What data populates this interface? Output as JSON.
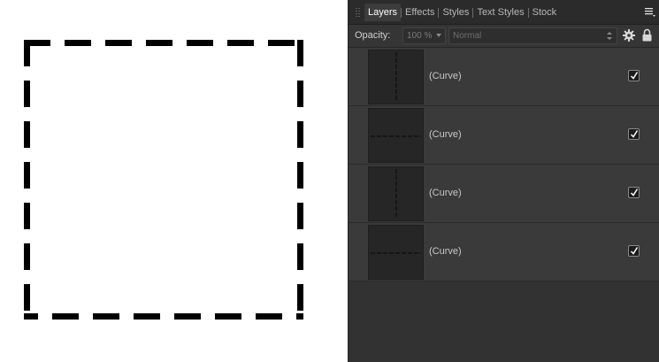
{
  "panel": {
    "tabs": [
      {
        "label": "Layers",
        "active": true
      },
      {
        "label": "Effects",
        "active": false
      },
      {
        "label": "Styles",
        "active": false
      },
      {
        "label": "Text Styles",
        "active": false
      },
      {
        "label": "Stock",
        "active": false
      }
    ],
    "menu_icon": "hamburger-menu-icon"
  },
  "toolbar": {
    "opacity_label": "Opacity:",
    "opacity_value": "100 %",
    "blend_mode": "Normal",
    "gear_icon": "gear-icon",
    "lock_icon": "lock-icon"
  },
  "layers": [
    {
      "name": "(Curve)",
      "visible": true,
      "thumb": "vertical-dashed-line"
    },
    {
      "name": "(Curve)",
      "visible": true,
      "thumb": "horizontal-dashed-line"
    },
    {
      "name": "(Curve)",
      "visible": true,
      "thumb": "vertical-dashed-line"
    },
    {
      "name": "(Curve)",
      "visible": true,
      "thumb": "horizontal-dashed-line"
    }
  ],
  "colors": {
    "panel_bg": "#323232",
    "canvas_bg": "#ffffff",
    "stroke": "#000000"
  }
}
